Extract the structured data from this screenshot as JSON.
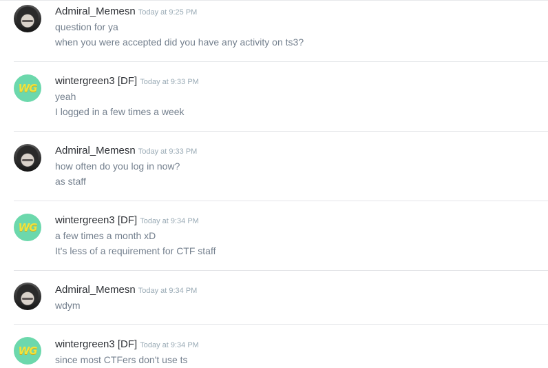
{
  "messages": [
    {
      "username": "Admiral_Memesn",
      "timestamp": "Today at 9:25 PM",
      "avatar": "photo-avatar",
      "lines": [
        "question for ya",
        "when you were accepted did you have any activity on ts3?"
      ]
    },
    {
      "username": "wintergreen3 [DF]",
      "timestamp": "Today at 9:33 PM",
      "avatar": "wg-avatar",
      "avatar_text": "WG",
      "lines": [
        "yeah",
        "I logged in a few times a week"
      ]
    },
    {
      "username": "Admiral_Memesn",
      "timestamp": "Today at 9:33 PM",
      "avatar": "photo-avatar",
      "lines": [
        "how often do you log in now?",
        "as staff"
      ]
    },
    {
      "username": "wintergreen3 [DF]",
      "timestamp": "Today at 9:34 PM",
      "avatar": "wg-avatar",
      "avatar_text": "WG",
      "lines": [
        "a few times a month xD",
        "It's less of a requirement for CTF staff"
      ]
    },
    {
      "username": "Admiral_Memesn",
      "timestamp": "Today at 9:34 PM",
      "avatar": "photo-avatar",
      "lines": [
        "wdym"
      ]
    },
    {
      "username": "wintergreen3 [DF]",
      "timestamp": "Today at 9:34 PM",
      "avatar": "wg-avatar",
      "avatar_text": "WG",
      "lines": [
        "since most CTFers don't use ts"
      ]
    }
  ],
  "colors": {
    "username": "#2e3136",
    "timestamp": "#99aab5",
    "message_text": "#737f8d",
    "divider": "#e3e5e8",
    "wg_avatar_bg": "#6cd8ac",
    "wg_avatar_text": "#f4e23a"
  }
}
